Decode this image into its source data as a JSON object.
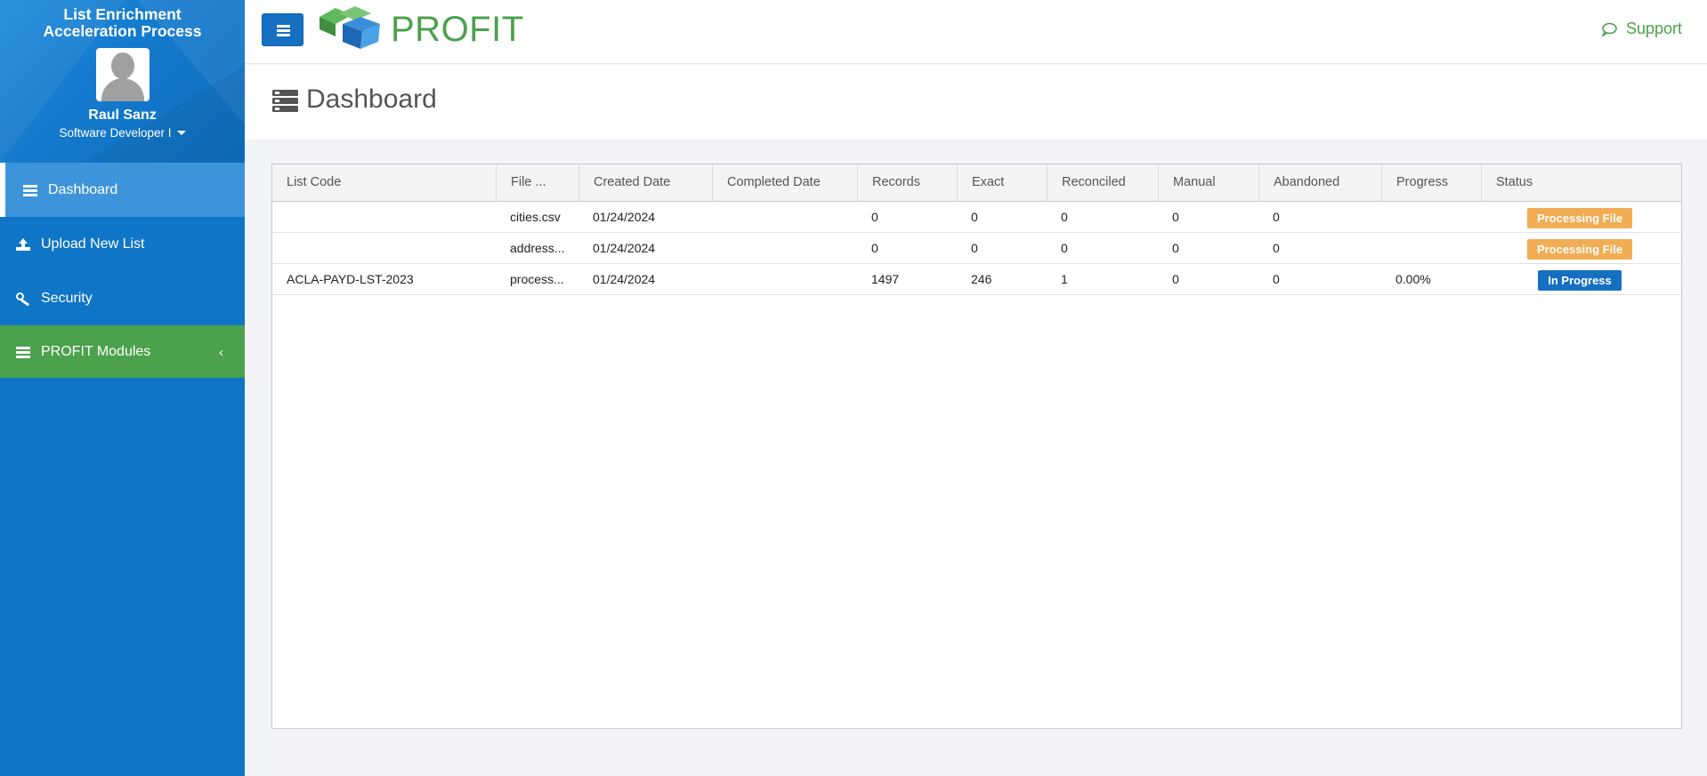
{
  "sidebar": {
    "app_title_line1": "List Enrichment",
    "app_title_line2": "Acceleration Process",
    "user_name": "Raul Sanz",
    "user_role": "Software Developer I",
    "items": [
      {
        "label": "Dashboard",
        "icon": "list-icon",
        "active": true
      },
      {
        "label": "Upload New List",
        "icon": "upload-icon"
      },
      {
        "label": "Security",
        "icon": "key-icon"
      },
      {
        "label": "PROFIT Modules",
        "icon": "list-icon",
        "chevron": "‹"
      }
    ]
  },
  "header": {
    "brand": "PROFIT",
    "support_label": "Support"
  },
  "page": {
    "title": "Dashboard"
  },
  "table": {
    "columns": [
      "List Code",
      "File ...",
      "Created Date",
      "Completed Date",
      "Records",
      "Exact",
      "Reconciled",
      "Manual",
      "Abandoned",
      "Progress",
      "Status"
    ],
    "rows": [
      {
        "list_code": "",
        "file": "cities.csv",
        "created": "01/24/2024",
        "completed": "",
        "records": "0",
        "exact": "0",
        "reconciled": "0",
        "manual": "0",
        "abandoned": "0",
        "progress": "",
        "status": "Processing File"
      },
      {
        "list_code": "",
        "file": "address...",
        "created": "01/24/2024",
        "completed": "",
        "records": "0",
        "exact": "0",
        "reconciled": "0",
        "manual": "0",
        "abandoned": "0",
        "progress": "",
        "status": "Processing File"
      },
      {
        "list_code": "ACLA-PAYD-LST-2023",
        "file": "process...",
        "created": "01/24/2024",
        "completed": "",
        "records": "1497",
        "exact": "246",
        "reconciled": "1",
        "manual": "0",
        "abandoned": "0",
        "progress": "0.00%",
        "status": "In Progress"
      }
    ]
  },
  "colors": {
    "sidebar_blue": "#0f75c6",
    "brand_green": "#4ca14c",
    "processing_orange": "#f1ad54",
    "in_progress_blue": "#1570c2"
  }
}
